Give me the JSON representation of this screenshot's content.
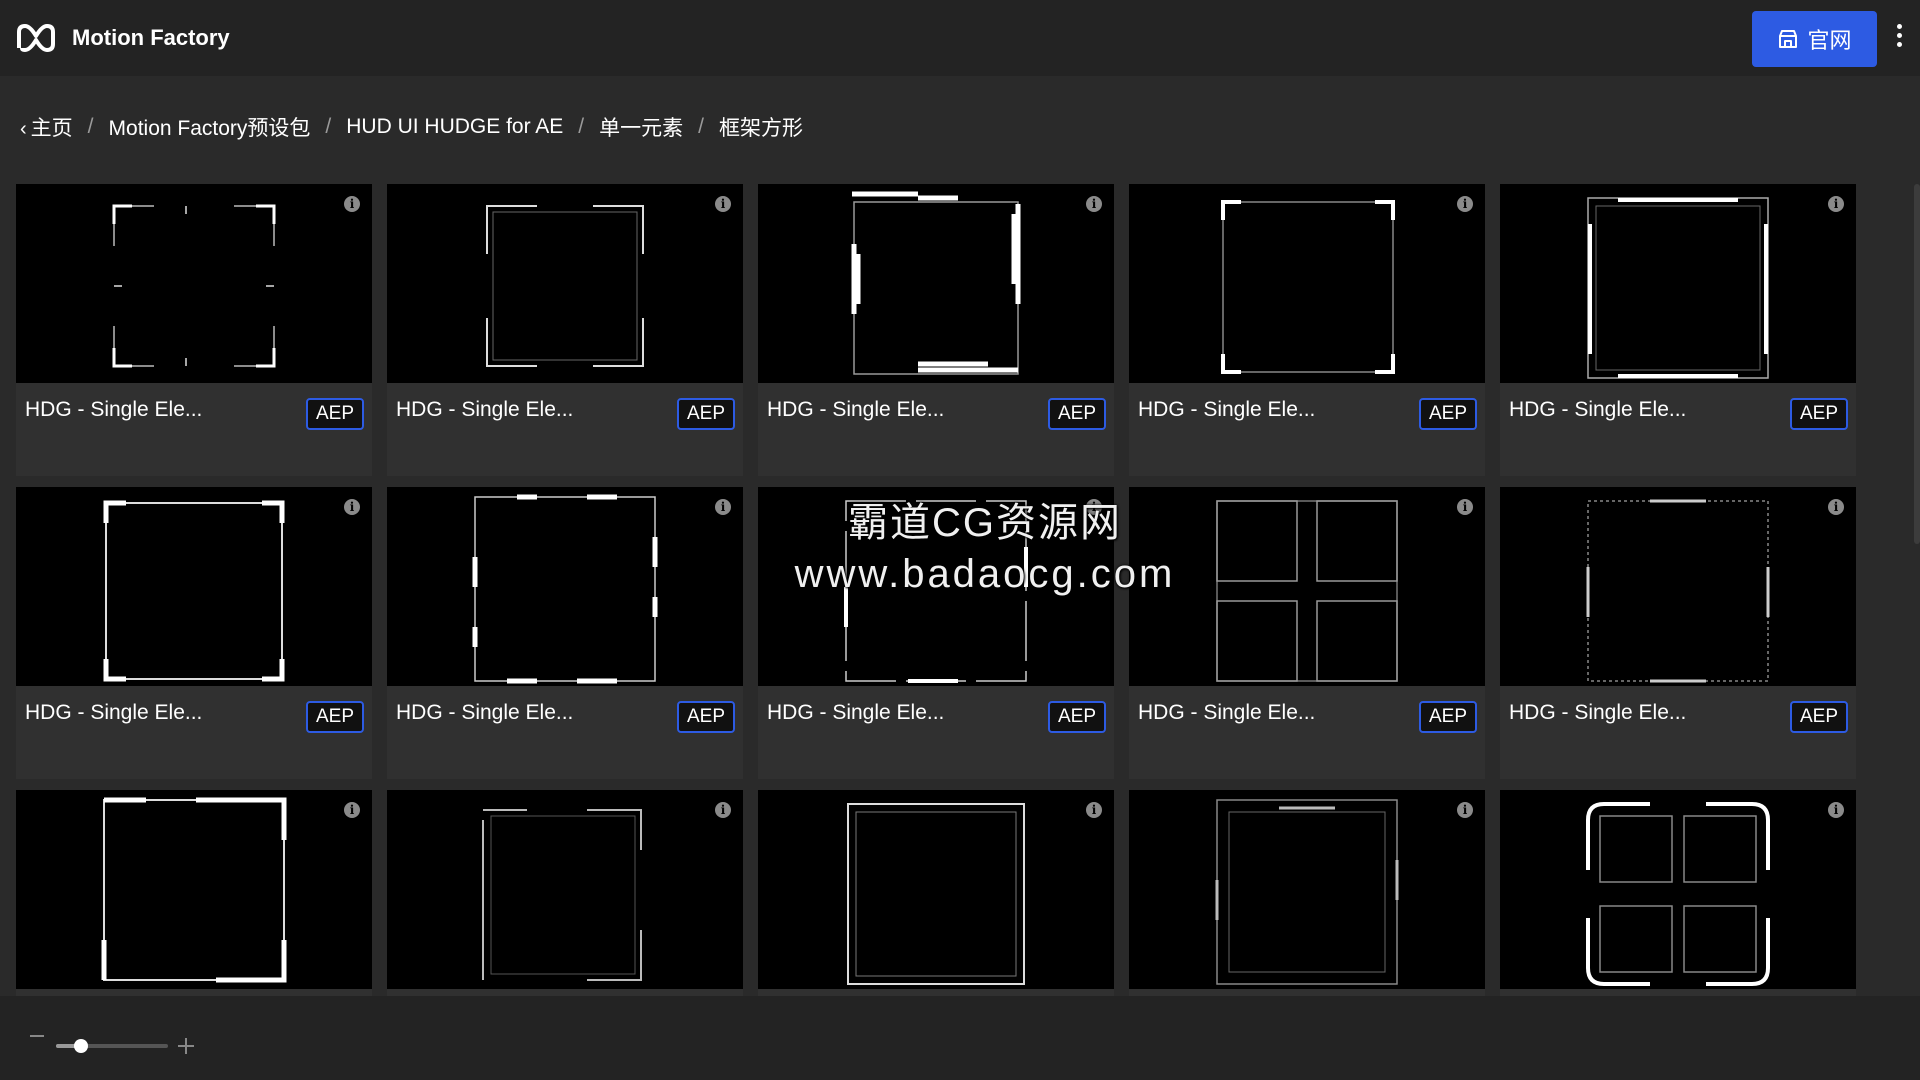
{
  "header": {
    "app_title": "Motion Factory",
    "logo_icon": "mf-logo-icon",
    "site_button_label": "官网",
    "site_button_icon": "store-icon",
    "accent_color": "#2d5be3"
  },
  "breadcrumb": {
    "items": [
      "主页",
      "Motion Factory预设包",
      "HUD UI HUDGE for AE",
      "单一元素",
      "框架方形"
    ],
    "separator": "/"
  },
  "cards": [
    {
      "title": "HDG - Single Ele...",
      "badge": "AEP"
    },
    {
      "title": "HDG - Single Ele...",
      "badge": "AEP"
    },
    {
      "title": "HDG - Single Ele...",
      "badge": "AEP"
    },
    {
      "title": "HDG - Single Ele...",
      "badge": "AEP"
    },
    {
      "title": "HDG - Single Ele...",
      "badge": "AEP"
    },
    {
      "title": "HDG - Single Ele...",
      "badge": "AEP"
    },
    {
      "title": "HDG - Single Ele...",
      "badge": "AEP"
    },
    {
      "title": "HDG - Single Ele...",
      "badge": "AEP"
    },
    {
      "title": "HDG - Single Ele...",
      "badge": "AEP"
    },
    {
      "title": "HDG - Single Ele...",
      "badge": "AEP"
    },
    {
      "title": "",
      "badge": ""
    },
    {
      "title": "",
      "badge": ""
    },
    {
      "title": "",
      "badge": ""
    },
    {
      "title": "",
      "badge": ""
    },
    {
      "title": "",
      "badge": ""
    }
  ],
  "zoom": {
    "level": 0.22
  },
  "watermark": {
    "line1": "霸道CG资源网",
    "line2": "www.badaocg.com"
  }
}
